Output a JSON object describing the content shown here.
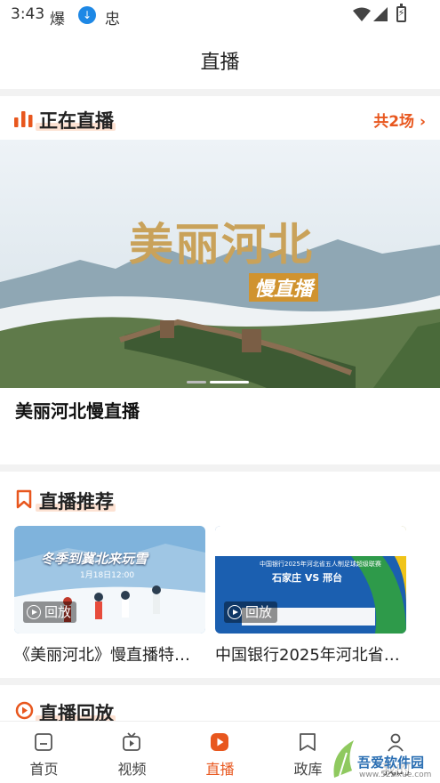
{
  "status_bar": {
    "time": "3:43",
    "icons": [
      "bao-icon",
      "download-icon",
      "bug-icon",
      "wifi-icon",
      "signal-icon",
      "battery-icon"
    ],
    "bao_glyph": "爆",
    "bug_glyph": "忠"
  },
  "header": {
    "title": "直播"
  },
  "live_now": {
    "title": "正在直播",
    "more_label": "共2场",
    "banner": {
      "art_title": "美丽河北",
      "art_subtitle": "慢直播",
      "caption": "美丽河北慢直播",
      "active_dot": 2,
      "dot_count": 2
    }
  },
  "recommend": {
    "title": "直播推荐",
    "cards": [
      {
        "title": "《美丽河北》慢直播特…",
        "badge": "回放",
        "thumb_text": "冬季到冀北来玩雪",
        "thumb_date": "1月18日12:00"
      },
      {
        "title": "中国银行2025年河北省…",
        "badge": "回放",
        "thumb_text": "中国银行2025年河北省五人制足球超级联赛",
        "thumb_subtitle": "石家庄 VS 邢台"
      }
    ]
  },
  "replay": {
    "title": "直播回放"
  },
  "bottom_nav": {
    "items": [
      {
        "label": "首页",
        "icon": "home-icon"
      },
      {
        "label": "视频",
        "icon": "video-icon"
      },
      {
        "label": "直播",
        "icon": "live-play-icon"
      },
      {
        "label": "政库",
        "icon": "bookmark-icon"
      },
      {
        "label": "我的",
        "icon": "profile-icon"
      }
    ],
    "active_index": 2
  },
  "watermark": {
    "text": "吾爱软件园",
    "url": "www.52zixue.com"
  },
  "colors": {
    "accent": "#e8571e",
    "highlight": "#fde2d3",
    "band": "#f2f2f2"
  }
}
